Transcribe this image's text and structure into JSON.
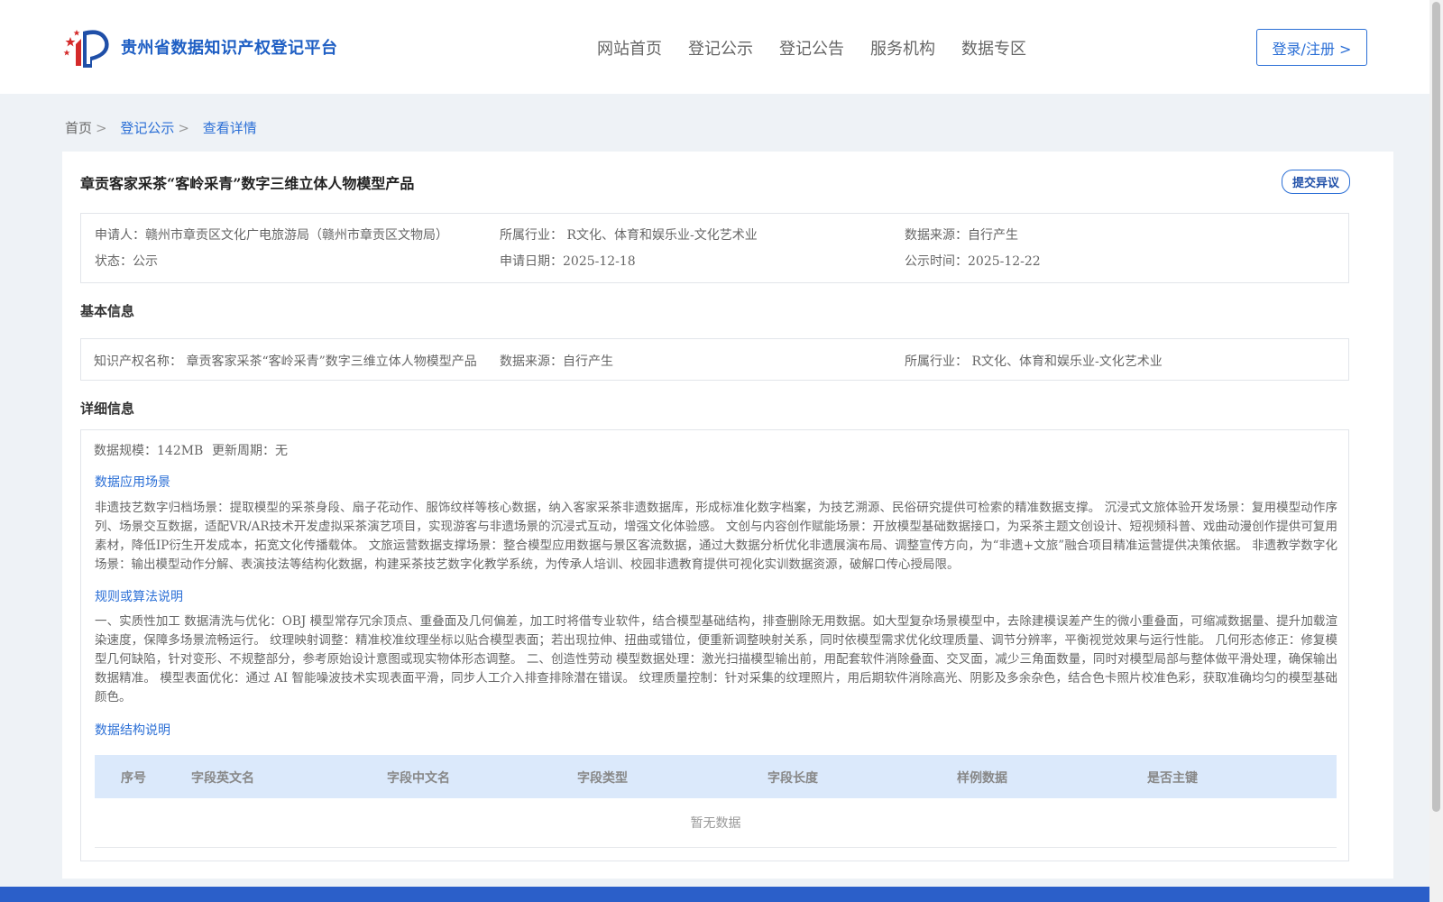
{
  "header": {
    "logo_text": "贵州省数据知识产权登记平台",
    "nav": [
      "网站首页",
      "登记公示",
      "登记公告",
      "服务机构",
      "数据专区"
    ],
    "login_label": "登录/注册 >"
  },
  "breadcrumb": {
    "home": "首页",
    "sep": ">",
    "level1": "登记公示",
    "current": "查看详情"
  },
  "detail": {
    "title": "章贡客家采茶“客岭采青”数字三维立体人物模型产品",
    "objection_label": "提交异议",
    "summary": {
      "applicant": "申请人：赣州市章贡区文化广电旅游局（赣州市章贡区文物局）",
      "industry": "所属行业： R文化、体育和娱乐业-文化艺术业",
      "source": "数据来源：自行产生",
      "status": "状态：公示",
      "apply_date": "申请日期：2025-12-18",
      "publish_date": "公示时间：2025-12-22"
    },
    "basic_title": "基本信息",
    "basic": {
      "ip_name": "知识产权名称： 章贡客家采茶“客岭采青”数字三维立体人物模型产品",
      "source": "数据来源：自行产生",
      "industry": "所属行业： R文化、体育和娱乐业-文化艺术业"
    },
    "detail_title": "详细信息",
    "scale": "数据规模：142MB",
    "update_cycle": "更新周期：无",
    "scene_title": "数据应用场景",
    "scene_text": "非遗技艺数字归档场景：提取模型的采茶身段、扇子花动作、服饰纹样等核心数据，纳入客家采茶非遗数据库，形成标准化数字档案，为技艺溯源、民俗研究提供可检索的精准数据支撑。 沉浸式文旅体验开发场景：复用模型动作序列、场景交互数据，适配VR/AR技术开发虚拟采茶演艺项目，实现游客与非遗场景的沉浸式互动，增强文化体验感。 文创与内容创作赋能场景：开放模型基础数据接口，为采茶主题文创设计、短视频科普、戏曲动漫创作提供可复用素材，降低IP衍生开发成本，拓宽文化传播载体。 文旅运营数据支撑场景：整合模型应用数据与景区客流数据，通过大数据分析优化非遗展演布局、调整宣传方向，为“非遗+文旅”融合项目精准运营提供决策依据。 非遗教学数字化场景：输出模型动作分解、表演技法等结构化数据，构建采茶技艺数字化教学系统，为传承人培训、校园非遗教育提供可视化实训数据资源，破解口传心授局限。",
    "rule_title": "规则或算法说明",
    "rule_text": "一、实质性加工 数据清洗与优化：OBJ 模型常存冗余顶点、重叠面及几何偏差，加工时将借专业软件，结合模型基础结构，排查删除无用数据。如大型复杂场景模型中，去除建模误差产生的微小重叠面，可缩减数据量、提升加载渲染速度，保障多场景流畅运行。 纹理映射调整：精准校准纹理坐标以贴合模型表面；若出现拉伸、扭曲或错位，便重新调整映射关系，同时依模型需求优化纹理质量、调节分辨率，平衡视觉效果与运行性能。 几何形态修正：修复模型几何缺陷，针对变形、不规整部分，参考原始设计意图或现实物体形态调整。 二、创造性劳动 模型数据处理：激光扫描模型输出前，用配套软件消除叠面、交叉面，减少三角面数量，同时对模型局部与整体做平滑处理，确保输出数据精准。 模型表面优化：通过 AI 智能噪波技术实现表面平滑，同步人工介入排查排除潜在错误。 纹理质量控制：针对采集的纹理照片，用后期软件消除高光、阴影及多余杂色，结合色卡照片校准色彩，获取准确均匀的模型基础颜色。",
    "struct_title": "数据结构说明",
    "table_headers": [
      "序号",
      "字段英文名",
      "字段中文名",
      "字段类型",
      "字段长度",
      "样例数据",
      "是否主键"
    ],
    "empty_text": "暂无数据"
  },
  "colors": {
    "accent": "#2b6fd6",
    "footer": "#2b5fc9",
    "table_head": "#dbe9fb"
  }
}
